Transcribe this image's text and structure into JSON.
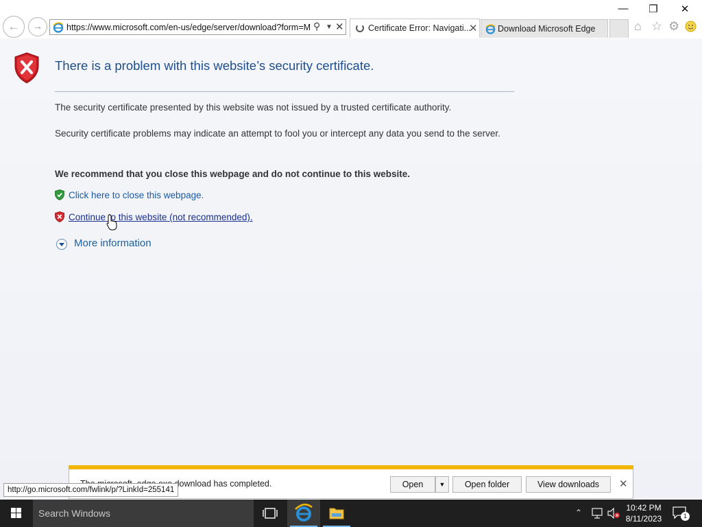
{
  "browser": {
    "address_url": "https://www.microsoft.com/en-us/edge/server/download?form=M",
    "tabs": [
      {
        "label": "Certificate Error: Navigati..."
      },
      {
        "label": "Download Microsoft Edge"
      }
    ]
  },
  "page": {
    "title": "There is a problem with this website’s security certificate.",
    "para1": "The security certificate presented by this website was not issued by a trusted certificate authority.",
    "para2": "Security certificate problems may indicate an attempt to fool you or intercept any data you send to the server.",
    "recommendation": "We recommend that you close this webpage and do not continue to this website.",
    "close_link": "Click here to close this webpage.",
    "continue_link": "Continue to this website (not recommended).",
    "more_info": "More information"
  },
  "status_bar": {
    "link_url": "http://go.microsoft.com/fwlink/p/?LinkId=255141"
  },
  "download_bar": {
    "message": "The microsoft_edge.exe download has completed.",
    "open_label": "Open",
    "open_folder_label": "Open folder",
    "view_downloads_label": "View downloads"
  },
  "taskbar": {
    "search_placeholder": "Search Windows",
    "time": "10:42 PM",
    "date": "8/11/2023",
    "notification_count": "1"
  },
  "colors": {
    "title_blue": "#1f4e8c",
    "link_blue": "#1a5aa6",
    "download_bar_accent": "#f2b600",
    "taskbar": "#1f1f1f"
  }
}
